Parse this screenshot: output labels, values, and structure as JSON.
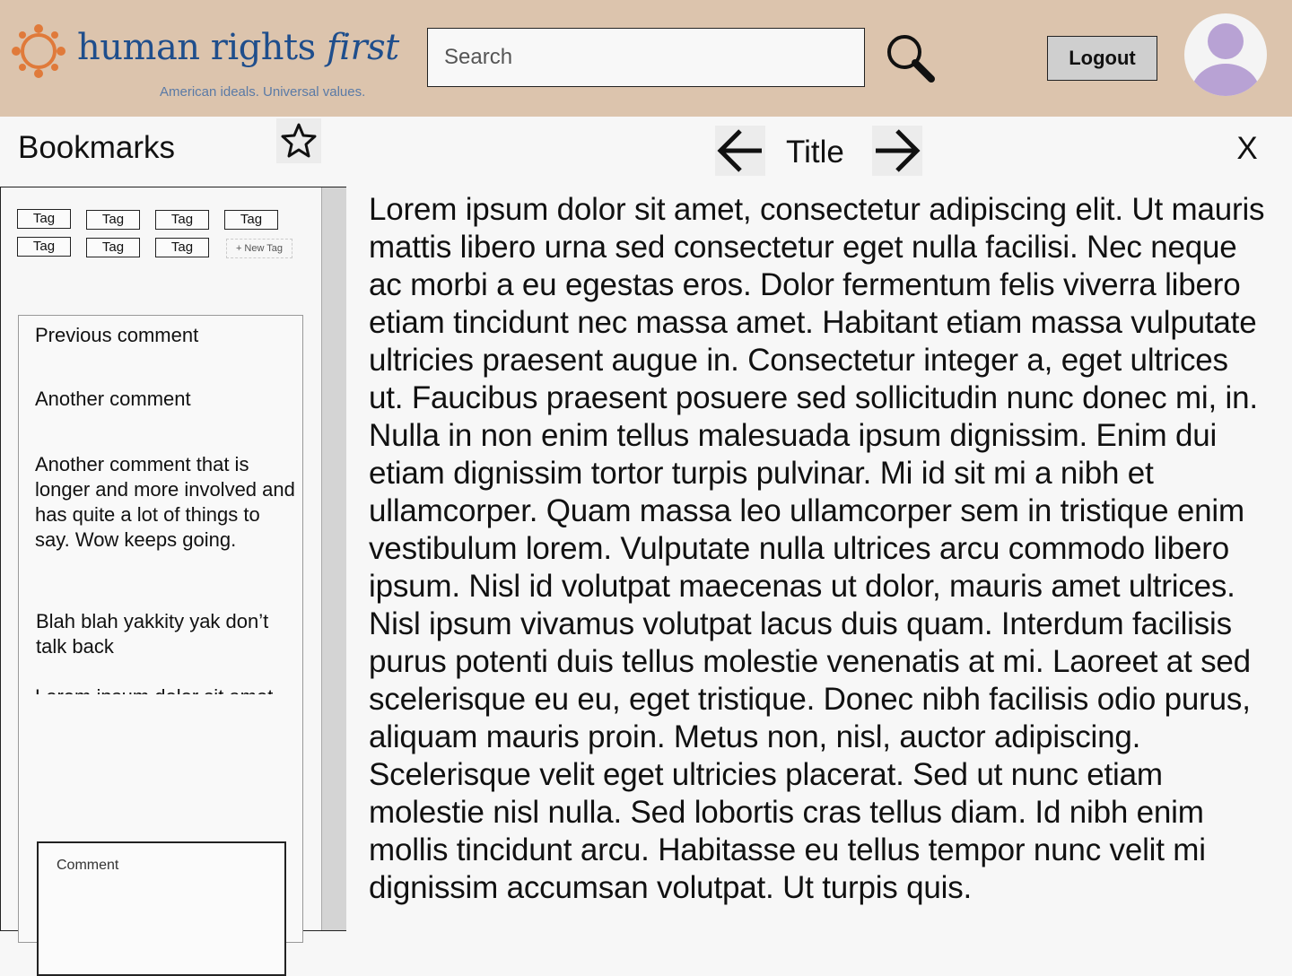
{
  "header": {
    "brand": {
      "word1": "human rights ",
      "word2": "first",
      "tagline": "American ideals. Universal values."
    },
    "search": {
      "placeholder": "Search"
    },
    "logout_label": "Logout"
  },
  "sidebar": {
    "title": "Bookmarks",
    "tags": [
      "Tag",
      "Tag",
      "Tag",
      "Tag",
      "Tag",
      "Tag",
      "Tag"
    ],
    "new_tag_label": "+ New Tag",
    "comments": [
      "Previous comment",
      "Another comment",
      "Another comment that is longer and more involved and has quite a lot of things to say. Wow keeps going.",
      "Blah blah yakkity yak don’t talk back",
      "Lorem ipsum dolor sit amet, consectetur adipiscing elit. Tempus justo, sed tincidunt diam nulla elit. Quisque duis malesuada facilisis ut in"
    ],
    "comment_placeholder": "Comment"
  },
  "document": {
    "title": "Title",
    "close_label": "X",
    "body": "Lorem ipsum dolor sit amet, consectetur adipiscing elit. Ut mauris mattis libero urna sed consectetur eget nulla facilisi. Nec neque ac morbi a eu egestas eros. Dolor fermentum felis viverra libero etiam tincidunt nec massa amet. Habitant etiam massa vulputate ultricies praesent augue in. Consectetur integer a, eget ultrices ut. Faucibus praesent posuere sed sollicitudin nunc donec mi, in. Nulla in non enim tellus malesuada ipsum dignissim. Enim dui etiam dignissim tortor turpis pulvinar. Mi id sit mi a nibh et ullamcorper. Quam massa leo ullamcorper sem in tristique enim vestibulum lorem. Vulputate nulla ultrices arcu commodo libero ipsum. Nisl id volutpat maecenas ut dolor, mauris amet ultrices. Nisl ipsum vivamus volutpat lacus duis quam. Interdum facilisis purus potenti duis tellus molestie venenatis at mi. Laoreet at sed scelerisque eu eu, eget tristique. Donec nibh facilisis odio purus, aliquam mauris proin. Metus non, nisl, auctor adipiscing. Scelerisque velit eget ultricies placerat. Sed ut nunc etiam molestie nisl nulla. Sed lobortis cras tellus diam. Id nibh enim mollis tincidunt arcu. Habitasse eu tellus tempor nunc velit mi dignissim accumsan volutpat. Ut turpis quis."
  },
  "colors": {
    "header_bg": "#dcc4ad",
    "brand_blue": "#1f4e8c",
    "logo_orange": "#e07a3a",
    "avatar_purple": "#b8a2d4"
  },
  "icons": [
    "logo-mark-icon",
    "search-icon",
    "avatar-icon",
    "star-icon",
    "arrow-left-icon",
    "arrow-right-icon"
  ]
}
